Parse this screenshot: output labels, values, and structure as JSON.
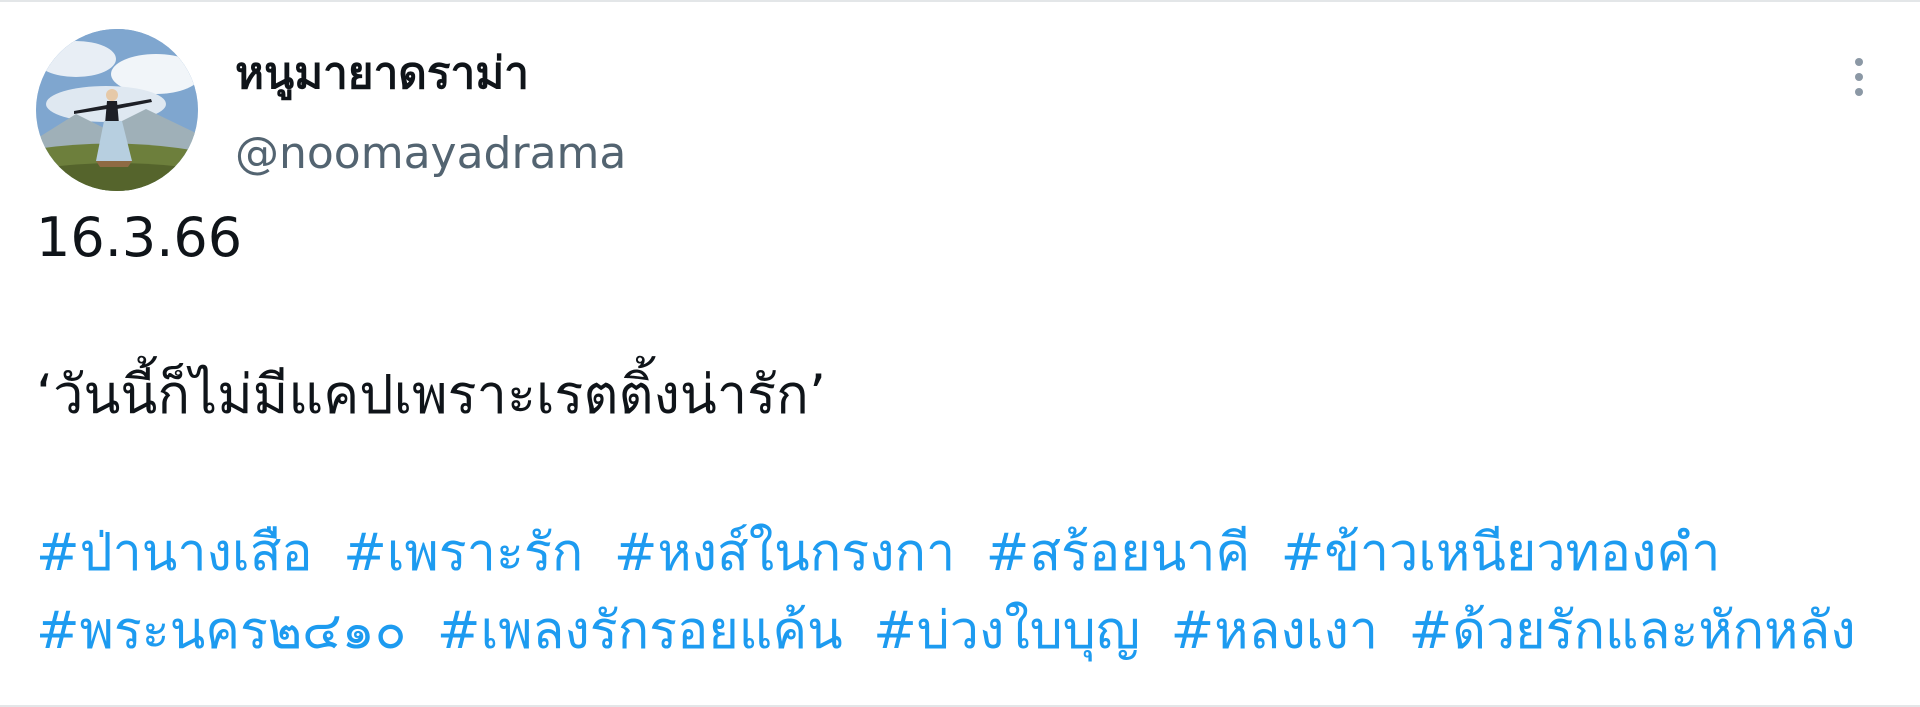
{
  "user": {
    "display_name": "หนูมายาดราม่า",
    "handle": "@noomayadrama"
  },
  "tweet": {
    "date_text": "16.3.66",
    "quote_text": "‘วันนี้ก็ไม่มีแคปเพราะเรตติ้งน่ารัก’",
    "hashtags_row1": [
      "#ป่านางเสือ",
      "#เพราะรัก",
      "#หงส์ในกรงกา",
      "#สร้อยนาคี",
      "#ข้าวเหนียวทองคำ"
    ],
    "hashtags_row2": [
      "#พระนคร๒๔๑๐",
      "#เพลงรักรอยแค้น",
      "#บ่วงใบบุญ",
      "#หลงเงา",
      "#ด้วยรักและหักหลัง"
    ]
  },
  "icons": {
    "more": "more-vertical-icon"
  },
  "colors": {
    "hashtag": "#1d9bf0",
    "handle": "#536471",
    "text": "#0f1419"
  }
}
